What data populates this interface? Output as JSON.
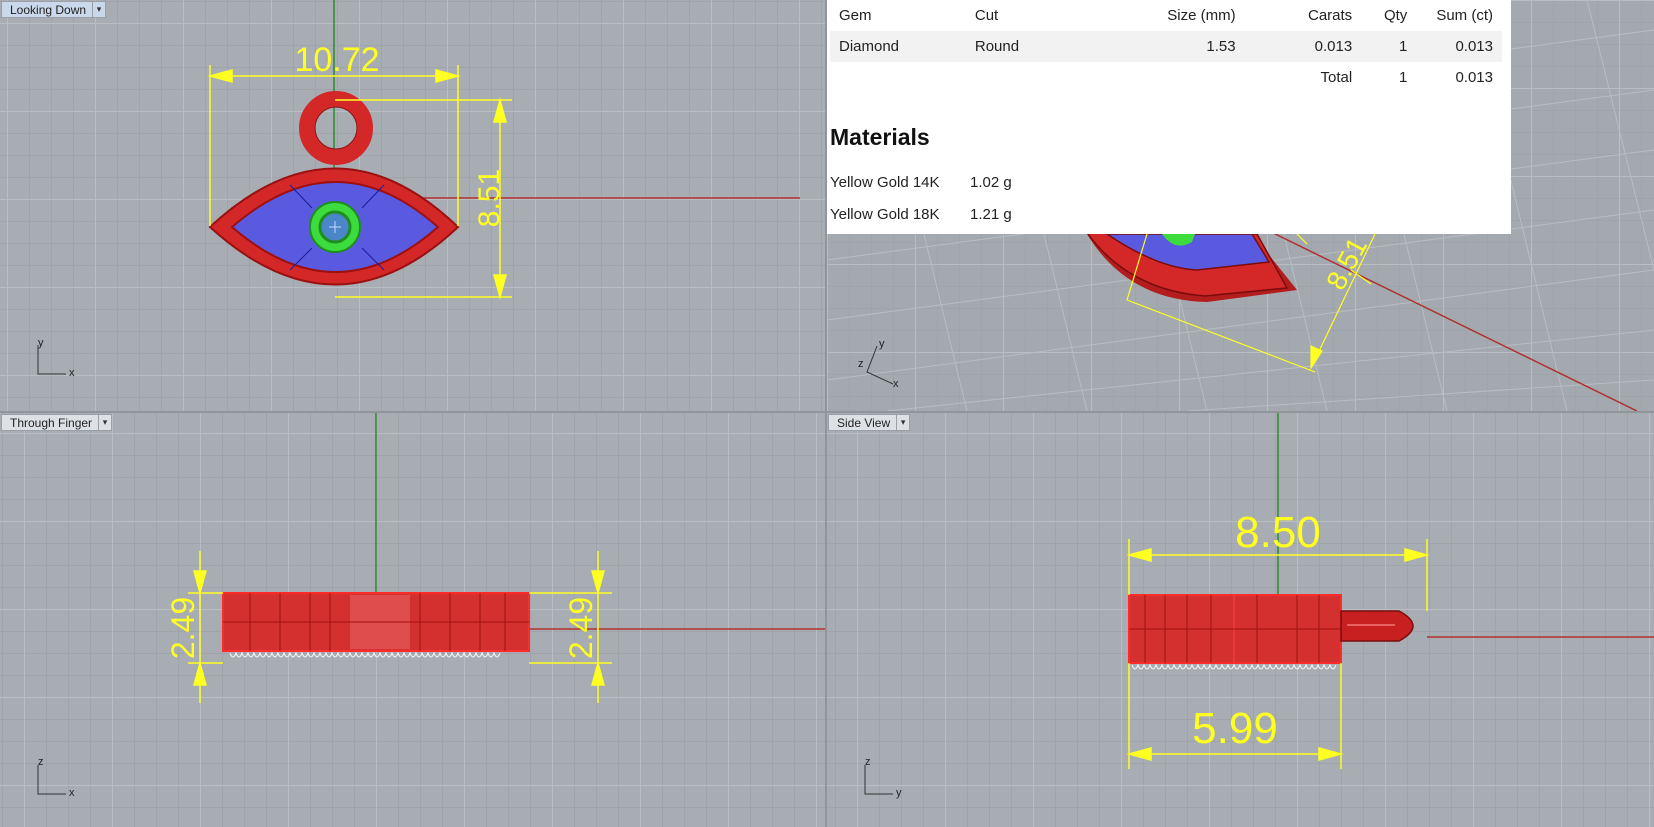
{
  "viewports": {
    "top_left": {
      "title": "Looking Down",
      "axis_v": "y",
      "axis_h": "x",
      "dims": {
        "width": "10.72",
        "height": "8.51"
      }
    },
    "top_right": {
      "axis_v": "y",
      "axis_h": "x",
      "axis_z": "z",
      "dims": {
        "height": "8.51"
      }
    },
    "bottom_left": {
      "title": "Through Finger",
      "axis_v": "z",
      "axis_h": "x",
      "dims": {
        "left": "2.49",
        "right": "2.49"
      }
    },
    "bottom_right": {
      "title": "Side View",
      "axis_v": "z",
      "axis_h": "y",
      "dims": {
        "top": "8.50",
        "bottom": "5.99"
      }
    }
  },
  "report": {
    "headers": [
      "Gem",
      "Cut",
      "Size (mm)",
      "Carats",
      "Qty",
      "Sum (ct)"
    ],
    "rows": [
      {
        "gem": "Diamond",
        "cut": "Round",
        "size": "1.53",
        "carats": "0.013",
        "qty": "1",
        "sum": "0.013"
      }
    ],
    "total": {
      "label": "Total",
      "qty": "1",
      "sum": "0.013"
    },
    "materials_title": "Materials",
    "materials": [
      {
        "name": "Yellow Gold 14K",
        "weight": "1.02 g"
      },
      {
        "name": "Yellow Gold 18K",
        "weight": "1.21 g"
      }
    ]
  },
  "colors": {
    "model_red": "#d42828",
    "stone_blue": "#5a5ae0",
    "bezel_green": "#3ddc3d",
    "dimension_yellow": "#ffff22",
    "axis_green": "#2d8a2d",
    "axis_red": "#b03030"
  }
}
